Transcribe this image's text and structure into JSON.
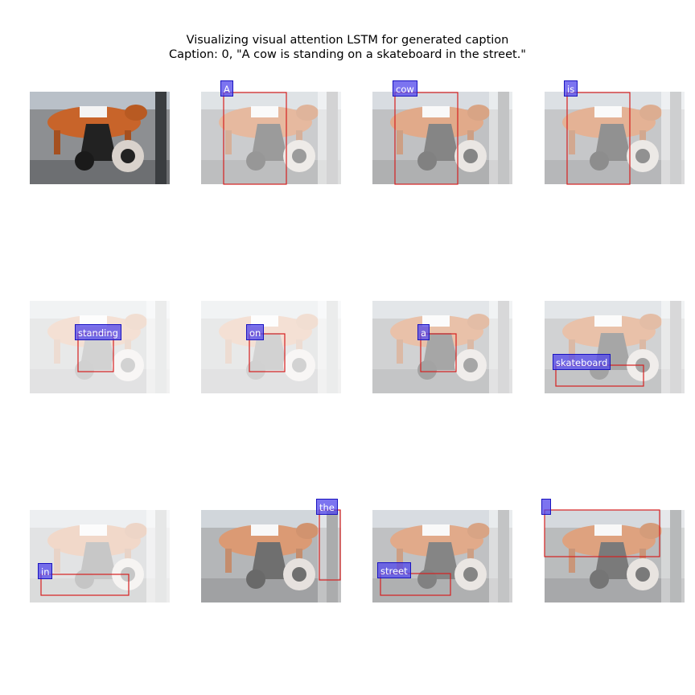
{
  "figure": {
    "title_line1": "Visualizing visual attention LSTM for generated caption",
    "title_line2": "Caption: 0, \"A cow is standing on a skateboard in the street.\""
  },
  "panels": [
    {
      "word": null,
      "kind": "original"
    },
    {
      "word": "A"
    },
    {
      "word": "cow"
    },
    {
      "word": "is"
    },
    {
      "word": "standing"
    },
    {
      "word": "on"
    },
    {
      "word": "a"
    },
    {
      "word": "skateboard"
    },
    {
      "word": "in"
    },
    {
      "word": "the"
    },
    {
      "word": "street"
    },
    {
      "word": ""
    }
  ],
  "colors": {
    "box_outline": "#d62020",
    "label_fill": "#5046eb",
    "cow_body": "#c8642a",
    "scooter": "#222222"
  }
}
